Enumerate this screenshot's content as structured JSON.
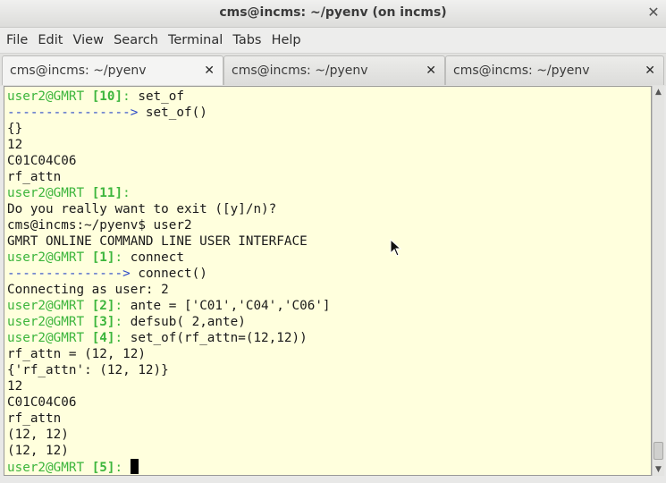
{
  "window": {
    "title": "cms@incms: ~/pyenv (on incms)",
    "close_glyph": "✕"
  },
  "menu": [
    "File",
    "Edit",
    "View",
    "Search",
    "Terminal",
    "Tabs",
    "Help"
  ],
  "tabs": [
    {
      "label": "cms@incms: ~/pyenv",
      "close": "✕",
      "active": true
    },
    {
      "label": "cms@incms: ~/pyenv",
      "close": "✕",
      "active": false
    },
    {
      "label": "cms@incms: ~/pyenv",
      "close": "✕",
      "active": false
    }
  ],
  "colors": {
    "terminal_bg": "#ffffdd",
    "prompt": "#3cb53c",
    "continuation_arrow": "#2b49c8",
    "text": "#1a1a1a"
  },
  "terminal": {
    "lines": [
      {
        "prompt": "user2@GMRT ",
        "num": "[10]",
        "tail": ": ",
        "cmd": "set_of"
      },
      {
        "arrow": "---------------->",
        "text": " set_of()"
      },
      {
        "text": "{}"
      },
      {
        "text": "12"
      },
      {
        "text": "C01C04C06"
      },
      {
        "text": "rf_attn"
      },
      {
        "prompt": "user2@GMRT ",
        "num": "[11]",
        "tail": ":",
        "cmd": ""
      },
      {
        "text": "Do you really want to exit ([y]/n)?"
      },
      {
        "text": "cms@incms:~/pyenv$ user2"
      },
      {
        "text": "GMRT ONLINE COMMAND LINE USER INTERFACE"
      },
      {
        "prompt": "user2@GMRT ",
        "num": "[1]",
        "tail": ": ",
        "cmd": "connect"
      },
      {
        "arrow": "--------------->",
        "text": " connect()"
      },
      {
        "text": "Connecting as user: 2"
      },
      {
        "prompt": "user2@GMRT ",
        "num": "[2]",
        "tail": ": ",
        "cmd": "ante = ['C01','C04','C06']"
      },
      {
        "prompt": "user2@GMRT ",
        "num": "[3]",
        "tail": ": ",
        "cmd": "defsub( 2,ante)"
      },
      {
        "prompt": "user2@GMRT ",
        "num": "[4]",
        "tail": ": ",
        "cmd": "set_of(rf_attn=(12,12))"
      },
      {
        "text": "rf_attn = (12, 12)"
      },
      {
        "text": "{'rf_attn': (12, 12)}"
      },
      {
        "text": "12"
      },
      {
        "text": "C01C04C06"
      },
      {
        "text": "rf_attn"
      },
      {
        "text": "(12, 12)"
      },
      {
        "text": "(12, 12)"
      },
      {
        "prompt": "user2@GMRT ",
        "num": "[5]",
        "tail": ": ",
        "cmd": "",
        "cursor": true
      }
    ]
  },
  "scrollbar": {
    "up_glyph": "▲",
    "down_glyph": "▼"
  }
}
